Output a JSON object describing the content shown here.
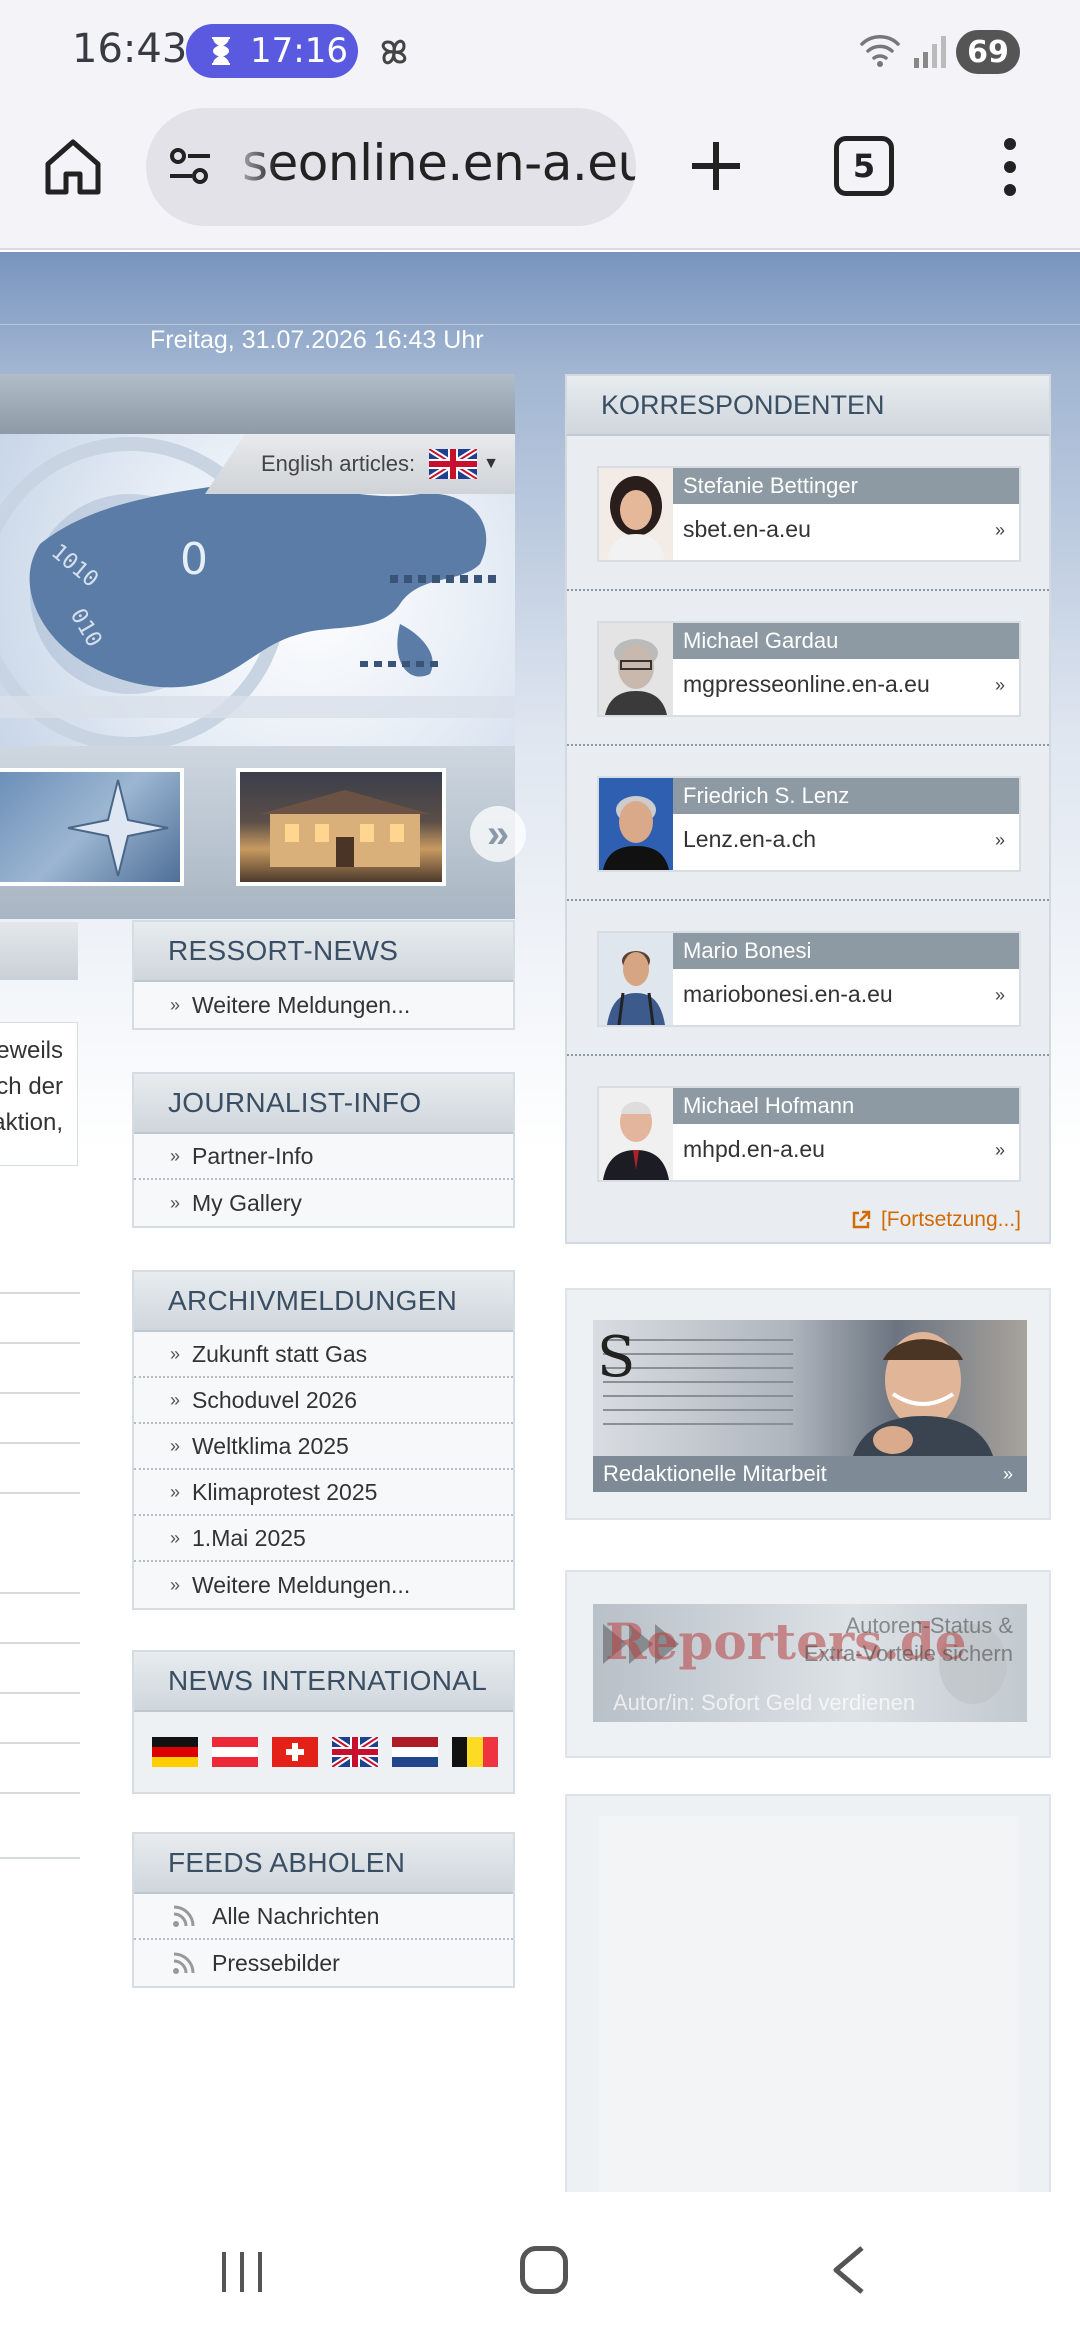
{
  "status_bar": {
    "time": "16:43",
    "timer": "17:16",
    "battery": "69"
  },
  "browser": {
    "url": "seonline.en-a.eu",
    "tab_count": "5"
  },
  "page": {
    "date": "Freitag, 31.07.2026 16:43 Uhr",
    "english_articles_label": "English articles:",
    "left_snippet": [
      "eweils",
      "ch der",
      "aktion,"
    ]
  },
  "ressort_news": {
    "title": "RESSORT-NEWS",
    "items": [
      "Weitere Meldungen..."
    ]
  },
  "journalist_info": {
    "title": "JOURNALIST-INFO",
    "items": [
      "Partner-Info",
      "My Gallery"
    ]
  },
  "archivmeldungen": {
    "title": "ARCHIVMELDUNGEN",
    "items": [
      "Zukunft statt Gas",
      "Schoduvel 2026",
      "Weltklima 2025",
      "Klimaprotest 2025",
      "1.Mai 2025",
      "Weitere Meldungen..."
    ]
  },
  "news_international": {
    "title": "NEWS INTERNATIONAL",
    "flags": [
      "germany-flag",
      "austria-flag",
      "switzerland-flag",
      "uk-flag",
      "netherlands-flag",
      "belgium-flag"
    ]
  },
  "feeds": {
    "title": "FEEDS ABHOLEN",
    "items": [
      "Alle Nachrichten",
      "Pressebilder"
    ]
  },
  "korrespondenten": {
    "title": "KORRESPONDENTEN",
    "people": [
      {
        "name": "Stefanie Bettinger",
        "site": "sbet.en-a.eu"
      },
      {
        "name": "Michael Gardau",
        "site": "mgpresseonline.en-a.eu"
      },
      {
        "name": "Friedrich S. Lenz",
        "site": "Lenz.en-a.ch"
      },
      {
        "name": "Mario Bonesi",
        "site": "mariobonesi.en-a.eu"
      },
      {
        "name": "Michael Hofmann",
        "site": "mhpd.en-a.eu"
      }
    ],
    "more": "[Fortsetzung...]"
  },
  "ads": {
    "redaktionell": "Redaktionelle Mitarbeit",
    "reporters_logo": "Reporters.de",
    "reporters_line1": "Autoren-Status &",
    "reporters_line2": "Extra-Vorteile sichern",
    "reporters_line3": "Autor/in: Sofort Geld verdienen"
  },
  "colors": {
    "accent_blue": "#5a5ae0",
    "header_blue": "#7894be",
    "link_orange": "#d26a00"
  }
}
